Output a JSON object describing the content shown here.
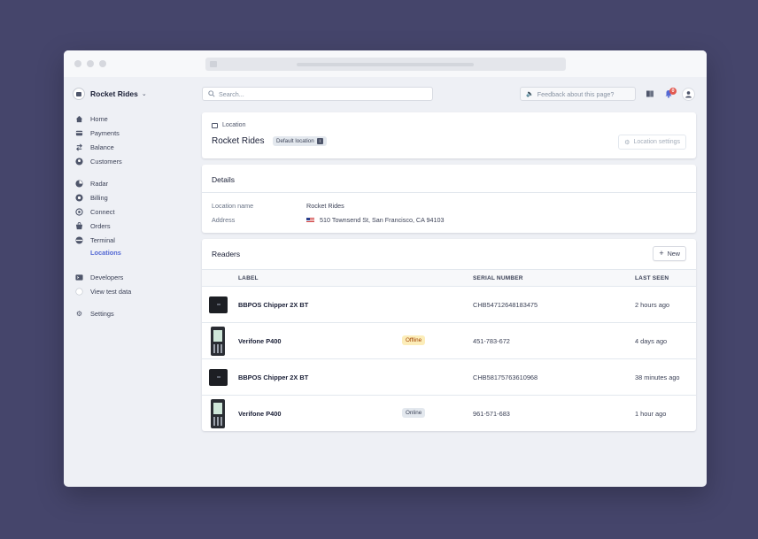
{
  "sidebar": {
    "account_name": "Rocket Rides",
    "nav_groups": [
      [
        {
          "label": "Home",
          "icon": "home-icon"
        },
        {
          "label": "Payments",
          "icon": "payments-icon"
        },
        {
          "label": "Balance",
          "icon": "balance-icon"
        },
        {
          "label": "Customers",
          "icon": "customers-icon"
        }
      ],
      [
        {
          "label": "Radar",
          "icon": "radar-icon"
        },
        {
          "label": "Billing",
          "icon": "billing-icon"
        },
        {
          "label": "Connect",
          "icon": "connect-icon"
        },
        {
          "label": "Orders",
          "icon": "orders-icon"
        },
        {
          "label": "Terminal",
          "icon": "terminal-icon"
        },
        {
          "label": "Locations",
          "icon": "",
          "active": true
        }
      ],
      [
        {
          "label": "Developers",
          "icon": "developers-icon"
        },
        {
          "label": "View test data",
          "icon": "toggle-icon"
        }
      ],
      [
        {
          "label": "Settings",
          "icon": "gear-icon"
        }
      ]
    ]
  },
  "topbar": {
    "search_placeholder": "Search...",
    "feedback_label": "Feedback about this page?",
    "notification_count": "0"
  },
  "location": {
    "type_label": "Location",
    "name": "Rocket Rides",
    "default_badge": "Default location",
    "settings_button": "Location settings"
  },
  "details": {
    "title": "Details",
    "fields": [
      {
        "label": "Location name",
        "value": "Rocket Rides"
      },
      {
        "label": "Address",
        "value": "510 Townsend St, San Francisco, CA 94103"
      }
    ]
  },
  "readers": {
    "title": "Readers",
    "new_button": "New",
    "columns": [
      "LABEL",
      "SERIAL NUMBER",
      "LAST SEEN"
    ],
    "rows": [
      {
        "device": "chipper",
        "label": "BBPOS Chipper 2X BT",
        "status": "",
        "serial": "CHB54712648183475",
        "last_seen": "2 hours ago"
      },
      {
        "device": "verifone",
        "label": "Verifone P400",
        "status": "Offline",
        "serial": "451-783-672",
        "last_seen": "4 days ago"
      },
      {
        "device": "chipper",
        "label": "BBPOS Chipper 2X BT",
        "status": "",
        "serial": "CHB58175763610968",
        "last_seen": "38 minutes ago"
      },
      {
        "device": "verifone",
        "label": "Verifone P400",
        "status": "Online",
        "serial": "961-571-683",
        "last_seen": "1 hour ago"
      }
    ]
  },
  "colors": {
    "background": "#45456b",
    "accent": "#5469d4",
    "offline_badge": "#fcedb9",
    "online_badge": "#e3e8ee"
  }
}
